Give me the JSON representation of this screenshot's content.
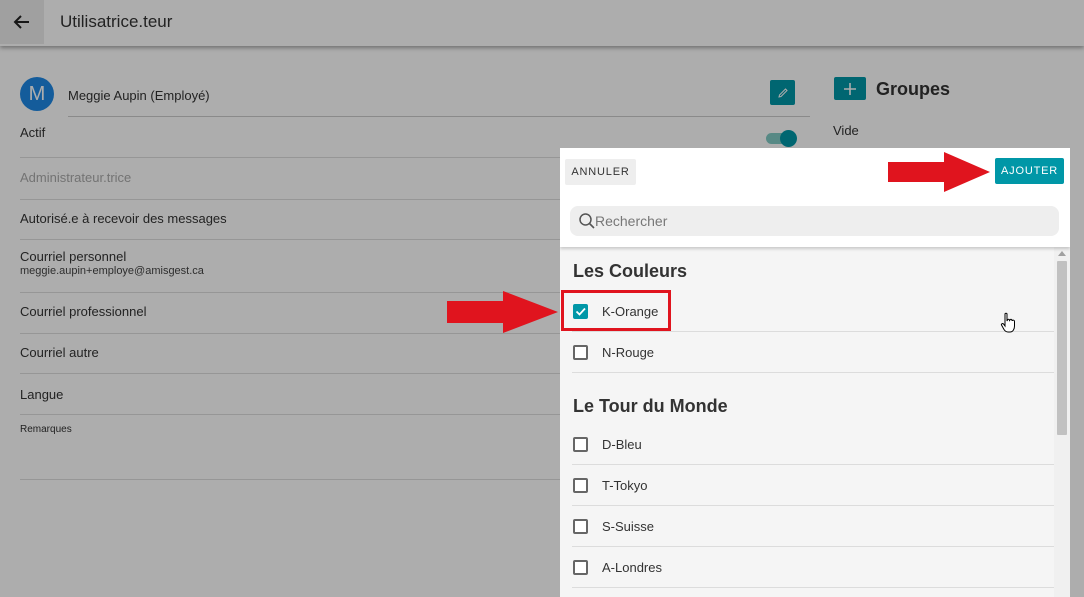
{
  "header": {
    "title": "Utilisatrice.teur"
  },
  "profile": {
    "avatar_letter": "M",
    "name": "Meggie Aupin (Employé)"
  },
  "fields": [
    {
      "label": "Actif"
    },
    {
      "label": "Administrateur.trice"
    },
    {
      "label": "Autorisé.e à recevoir des messages"
    },
    {
      "label": "Courriel personnel",
      "value": "meggie.aupin+employe@amisgest.ca"
    },
    {
      "label": "Courriel professionnel"
    },
    {
      "label": "Courriel autre"
    },
    {
      "label": "Langue"
    },
    {
      "label": "Remarques"
    }
  ],
  "groups": {
    "title": "Groupes",
    "empty_text": "Vide"
  },
  "dialog": {
    "cancel_label": "ANNULER",
    "add_label": "AJOUTER",
    "search_placeholder": "Rechercher",
    "sections": [
      {
        "title": "Les Couleurs",
        "items": [
          {
            "label": "K-Orange",
            "checked": true
          },
          {
            "label": "N-Rouge",
            "checked": false
          }
        ]
      },
      {
        "title": "Le Tour du Monde",
        "items": [
          {
            "label": "D-Bleu",
            "checked": false
          },
          {
            "label": "T-Tokyo",
            "checked": false
          },
          {
            "label": "S-Suisse",
            "checked": false
          },
          {
            "label": "A-Londres",
            "checked": false
          }
        ]
      }
    ]
  },
  "colors": {
    "accent": "#0097a7",
    "annotation": "#e0141e",
    "avatar": "#1e88e5"
  }
}
